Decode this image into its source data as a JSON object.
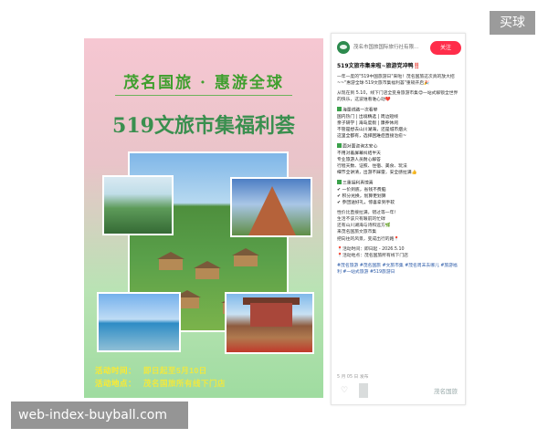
{
  "badge": {
    "label": "买球"
  },
  "watermark": {
    "text": "web-index-buyball.com"
  },
  "poster": {
    "line1": "茂名国旅 · 惠游全球",
    "line2": "519文旅市集福利荟",
    "event_time_label": "活动时间：",
    "event_time_value": "即日起至5月10日",
    "event_place_label": "活动地点：",
    "event_place_value": "茂名国旅所有线下门店"
  },
  "panel": {
    "account": "茂名市国旅国际旅行社有限...",
    "follow_label": "关注",
    "title": "519文旅市集来啦~旅游党冲鸭‼️",
    "paragraphs": [
      "一年一度的\"519中国旅游日\"来啦！茂名国旅这次真的放大招~~\"惠游全球·519文旅市集福利荟\"重磅开启🎉",
      "从现在到 5.10，线下门店全变身旅游市集😍一站式解锁全世界的快乐，这波谁看谁心动❤️"
    ],
    "sections": [
      {
        "head": "海量线路一次看够",
        "lines": [
          "国内热门 | 出境精选 | 周边短线",
          "亲子研学 | 海岛度假 | 康养休闲",
          "不管是想去山川湖海，还是城市烟火",
          "这里全都有，选择困难症直接治愈~"
        ]
      },
      {
        "head": "面对面咨询太安心",
        "lines": [
          "不用对着屏幕纠结半天",
          "专业旅游人员耐心解答",
          "行程天数、证照、住宿、美食、玩法",
          "细节全讲清，出游不踩雷，安全感拉满👍"
        ]
      },
      {
        "head": "三重福利真惊喜",
        "lines": [
          "✔ 一价到底，省钱不费脑",
          "✔ 积分兑换，划算更划算",
          "✔ 参团送好礼，惊喜拿到手软"
        ]
      }
    ],
    "closing": [
      "性价比直接拉满，错过等一年！",
      "生活不该只有眼前的忙碌",
      "还有山川湖海与诗和远方🌿",
      "来茂名国旅文旅市集",
      "把向往的风景，变成出行的路📍"
    ],
    "event_time": "📍活动时间：即日起 - 2026.5.10",
    "event_place": "📍活动地点：茂名国旅所有线下门店",
    "hashtags": "#茂名旅游 #茂名国旅 #文旅市集 #茂名周末去哪儿 #旅游福利 #一站式旅游 #519旅游日",
    "footer": "5 月 05 日 发布",
    "watermark": "茂名国旅",
    "heart_icon": "heart-icon"
  }
}
